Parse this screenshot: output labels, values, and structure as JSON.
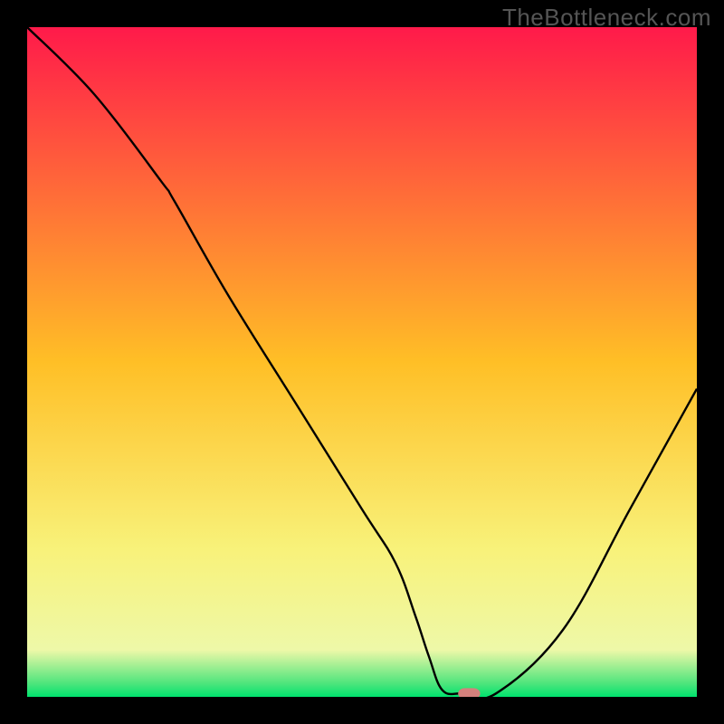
{
  "watermark": "TheBottleneck.com",
  "chart_data": {
    "type": "line",
    "title": "",
    "xlabel": "",
    "ylabel": "",
    "xlim": [
      0,
      100
    ],
    "ylim": [
      0,
      100
    ],
    "grid": false,
    "legend": false,
    "background_gradient": {
      "stops": [
        {
          "offset": 0.0,
          "color": "#ff1a4a"
        },
        {
          "offset": 0.5,
          "color": "#ffbf26"
        },
        {
          "offset": 0.78,
          "color": "#f8f27a"
        },
        {
          "offset": 0.93,
          "color": "#eef8a8"
        },
        {
          "offset": 0.98,
          "color": "#4ee57c"
        },
        {
          "offset": 1.0,
          "color": "#00e36e"
        }
      ]
    },
    "series": [
      {
        "name": "bottleneck-curve",
        "color": "#000000",
        "x": [
          0,
          10,
          20,
          22,
          30,
          40,
          50,
          55,
          58,
          60,
          62,
          65,
          70,
          80,
          90,
          100
        ],
        "y": [
          100,
          90,
          77,
          74,
          60,
          44,
          28,
          20,
          12,
          6,
          1,
          0.5,
          0.5,
          10,
          28,
          46
        ]
      }
    ],
    "marker": {
      "name": "min-marker",
      "x": 66,
      "y": 0.5,
      "width": 3.3,
      "height": 1.6,
      "rx": 1.0,
      "color": "#d4817c"
    }
  }
}
